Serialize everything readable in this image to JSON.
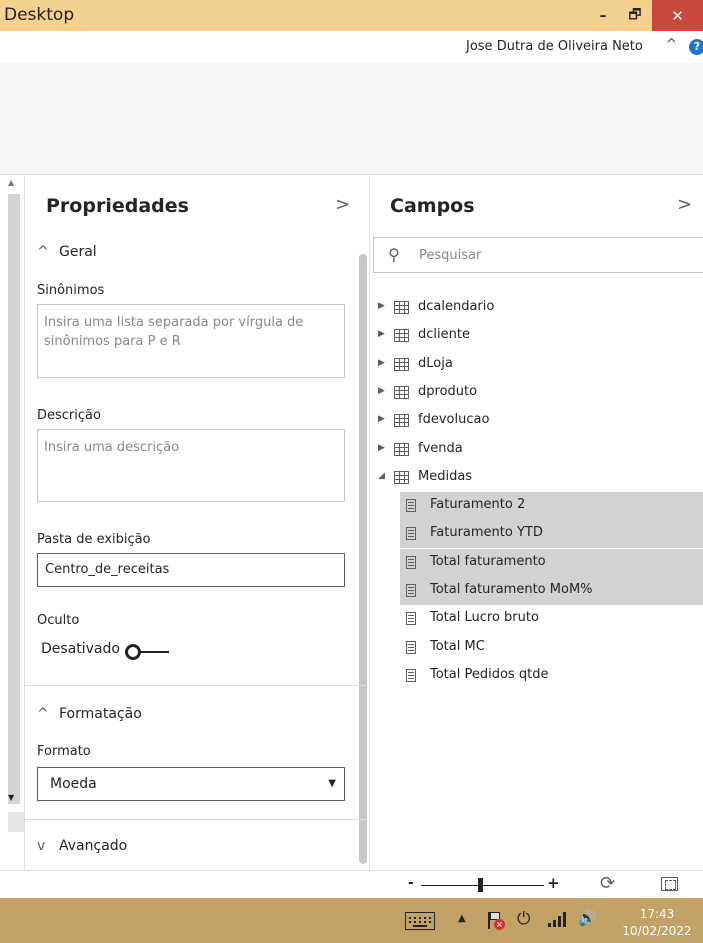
{
  "window": {
    "title": "Desktop",
    "minimize": "–",
    "maximize": "🗗",
    "close": "✕"
  },
  "user": {
    "name": "Jose Dutra de Oliveira Neto",
    "collapse_icon": "^",
    "help_icon": "?"
  },
  "properties": {
    "title": "Propriedades",
    "chevron": ">",
    "general_section": "Geral",
    "synonyms_label": "Sinônimos",
    "synonyms_placeholder": "Insira uma lista separada por vírgula de sinônimos para P e R",
    "description_label": "Descrição",
    "description_placeholder": "Insira uma descrição",
    "display_folder_label": "Pasta de exibição",
    "display_folder_value": "Centro_de_receitas",
    "hidden_label": "Oculto",
    "hidden_state": "Desativado",
    "hidden_on": false,
    "formatting_section": "Formatação",
    "format_label": "Formato",
    "format_value": "Moeda",
    "advanced_section": "Avançado",
    "section_collapse_icon": "^",
    "section_expand_icon": "v"
  },
  "fields": {
    "title": "Campos",
    "chevron": ">",
    "search_placeholder": "Pesquisar",
    "tables": [
      {
        "name": "dcalendario",
        "expanded": false
      },
      {
        "name": "dcliente",
        "expanded": false
      },
      {
        "name": "dLoja",
        "expanded": false
      },
      {
        "name": "dproduto",
        "expanded": false
      },
      {
        "name": "fdevolucao",
        "expanded": false
      },
      {
        "name": "fvenda",
        "expanded": false
      },
      {
        "name": "Medidas",
        "expanded": true
      }
    ],
    "measures": [
      {
        "name": "Faturamento 2",
        "selected": true
      },
      {
        "name": "Faturamento YTD",
        "selected": true
      },
      {
        "name": "Total faturamento",
        "selected": true
      },
      {
        "name": "Total faturamento MoM%",
        "selected": true
      },
      {
        "name": "Total Lucro bruto",
        "selected": false
      },
      {
        "name": "Total MC",
        "selected": false
      },
      {
        "name": "Total Pedidos qtde",
        "selected": false
      }
    ]
  },
  "statusbar": {
    "zoom_minus": "-",
    "zoom_plus": "+",
    "zoom_level_fraction": 0.48,
    "refresh_icon": "⟳"
  },
  "taskbar": {
    "time": "17:43",
    "date": "10/02/2022"
  },
  "colors": {
    "title_bar": "#f3d290",
    "close_button": "#c9473d",
    "taskbar": "#c2a266",
    "selected_row": "#d2d2d2",
    "help_icon": "#1e73d8"
  }
}
